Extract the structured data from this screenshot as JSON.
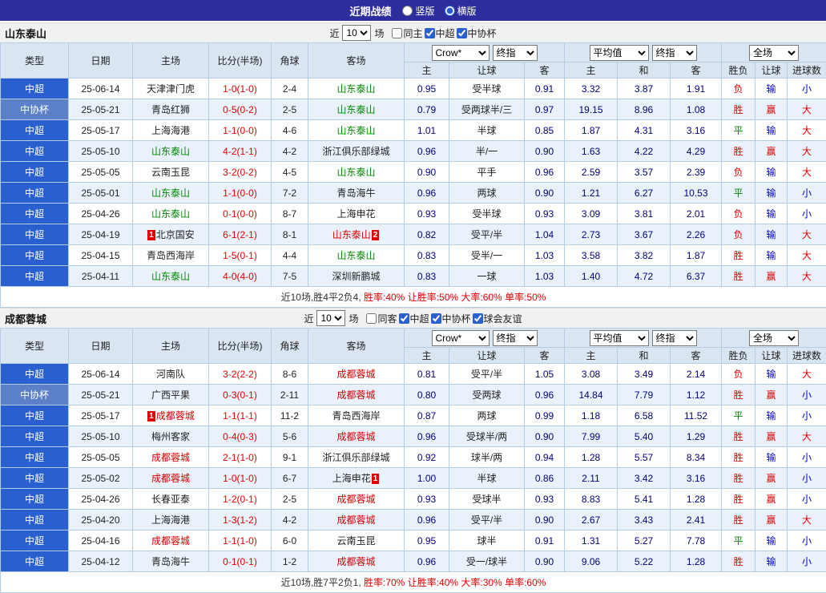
{
  "title_bar": {
    "title": "近期战绩",
    "radios": [
      {
        "label": "竖版",
        "checked": false
      },
      {
        "label": "横版",
        "checked": true
      }
    ]
  },
  "columns": {
    "type": "类型",
    "date": "日期",
    "home": "主场",
    "score": "比分(半场)",
    "corner": "角球",
    "away": "客场",
    "odds_home": "主",
    "handicap": "让球",
    "odds_away": "客",
    "avg_home": "主",
    "avg_draw": "和",
    "avg_away": "客",
    "result": "胜负",
    "handicap_result": "让球",
    "goals": "进球数"
  },
  "selects": {
    "bookmaker": "Crow*",
    "final_odds": "终指",
    "average": "平均值",
    "fulltime": "全场"
  },
  "sections": [
    {
      "team": "山东泰山",
      "filter": {
        "prefix": "近",
        "count": "10",
        "suffix": "场",
        "options": [
          {
            "label": "同主",
            "checked": false
          },
          {
            "label": "中超",
            "checked": true
          },
          {
            "label": "中协杯",
            "checked": true
          }
        ]
      },
      "rows": [
        [
          "中超",
          "25-06-14",
          {
            "n": "天津津门虎"
          },
          "1-0(1-0)",
          "2-4",
          {
            "n": "山东泰山",
            "c": "green"
          },
          "0.95",
          "受半球",
          "0.91",
          "3.32",
          "3.87",
          "1.91",
          "负",
          "输",
          "小"
        ],
        [
          "中协杯",
          "25-05-21",
          {
            "n": "青岛红狮"
          },
          "0-5(0-2)",
          "2-5",
          {
            "n": "山东泰山",
            "c": "green"
          },
          "0.79",
          "受两球半/三",
          "0.97",
          "19.15",
          "8.96",
          "1.08",
          "胜",
          "赢",
          "大"
        ],
        [
          "中超",
          "25-05-17",
          {
            "n": "上海海港"
          },
          "1-1(0-0)",
          "4-6",
          {
            "n": "山东泰山",
            "c": "green"
          },
          "1.01",
          "半球",
          "0.85",
          "1.87",
          "4.31",
          "3.16",
          "平",
          "输",
          "大"
        ],
        [
          "中超",
          "25-05-10",
          {
            "n": "山东泰山",
            "c": "green"
          },
          "4-2(1-1)",
          "4-2",
          {
            "n": "浙江俱乐部绿城"
          },
          "0.96",
          "半/一",
          "0.90",
          "1.63",
          "4.22",
          "4.29",
          "胜",
          "赢",
          "大"
        ],
        [
          "中超",
          "25-05-05",
          {
            "n": "云南玉昆"
          },
          "3-2(0-2)",
          "4-5",
          {
            "n": "山东泰山",
            "c": "green"
          },
          "0.90",
          "平手",
          "0.96",
          "2.59",
          "3.57",
          "2.39",
          "负",
          "输",
          "大"
        ],
        [
          "中超",
          "25-05-01",
          {
            "n": "山东泰山",
            "c": "green"
          },
          "1-1(0-0)",
          "7-2",
          {
            "n": "青岛海牛"
          },
          "0.96",
          "两球",
          "0.90",
          "1.21",
          "6.27",
          "10.53",
          "平",
          "输",
          "小"
        ],
        [
          "中超",
          "25-04-26",
          {
            "n": "山东泰山",
            "c": "green"
          },
          "0-1(0-0)",
          "8-7",
          {
            "n": "上海申花"
          },
          "0.93",
          "受半球",
          "0.93",
          "3.09",
          "3.81",
          "2.01",
          "负",
          "输",
          "小"
        ],
        [
          "中超",
          "25-04-19",
          {
            "n": "北京国安",
            "bb": "1"
          },
          "6-1(2-1)",
          "8-1",
          {
            "n": "山东泰山",
            "c": "red",
            "ba": "2"
          },
          "0.82",
          "受平/半",
          "1.04",
          "2.73",
          "3.67",
          "2.26",
          "负",
          "输",
          "大"
        ],
        [
          "中超",
          "25-04-15",
          {
            "n": "青岛西海岸"
          },
          "1-5(0-1)",
          "4-4",
          {
            "n": "山东泰山",
            "c": "green"
          },
          "0.83",
          "受半/一",
          "1.03",
          "3.58",
          "3.82",
          "1.87",
          "胜",
          "输",
          "大"
        ],
        [
          "中超",
          "25-04-11",
          {
            "n": "山东泰山",
            "c": "green"
          },
          "4-0(4-0)",
          "7-5",
          {
            "n": "深圳新鹏城"
          },
          "0.83",
          "一球",
          "1.03",
          "1.40",
          "4.72",
          "6.37",
          "胜",
          "赢",
          "大"
        ]
      ],
      "summary": [
        {
          "t": "近10场,胜4平2负4, ",
          "c": "dark"
        },
        {
          "t": "胜率:40% ",
          "c": "red"
        },
        {
          "t": "让胜率:50% ",
          "c": "red"
        },
        {
          "t": "大率:60% ",
          "c": "red"
        },
        {
          "t": "单率:50%",
          "c": "red"
        }
      ]
    },
    {
      "team": "成都蓉城",
      "filter": {
        "prefix": "近",
        "count": "10",
        "suffix": "场",
        "options": [
          {
            "label": "同客",
            "checked": false
          },
          {
            "label": "中超",
            "checked": true
          },
          {
            "label": "中协杯",
            "checked": true
          },
          {
            "label": "球会友谊",
            "checked": true
          }
        ]
      },
      "rows": [
        [
          "中超",
          "25-06-14",
          {
            "n": "河南队"
          },
          "3-2(2-2)",
          "8-6",
          {
            "n": "成都蓉城",
            "c": "red"
          },
          "0.81",
          "受平/半",
          "1.05",
          "3.08",
          "3.49",
          "2.14",
          "负",
          "输",
          "大"
        ],
        [
          "中协杯",
          "25-05-21",
          {
            "n": "广西平果"
          },
          "0-3(0-1)",
          "2-11",
          {
            "n": "成都蓉城",
            "c": "red"
          },
          "0.80",
          "受两球",
          "0.96",
          "14.84",
          "7.79",
          "1.12",
          "胜",
          "赢",
          "小"
        ],
        [
          "中超",
          "25-05-17",
          {
            "n": "成都蓉城",
            "c": "red",
            "bb": "1"
          },
          "1-1(1-1)",
          "11-2",
          {
            "n": "青岛西海岸"
          },
          "0.87",
          "两球",
          "0.99",
          "1.18",
          "6.58",
          "11.52",
          "平",
          "输",
          "小"
        ],
        [
          "中超",
          "25-05-10",
          {
            "n": "梅州客家"
          },
          "0-4(0-3)",
          "5-6",
          {
            "n": "成都蓉城",
            "c": "red"
          },
          "0.96",
          "受球半/两",
          "0.90",
          "7.99",
          "5.40",
          "1.29",
          "胜",
          "赢",
          "大"
        ],
        [
          "中超",
          "25-05-05",
          {
            "n": "成都蓉城",
            "c": "red"
          },
          "2-1(1-0)",
          "9-1",
          {
            "n": "浙江俱乐部绿城"
          },
          "0.92",
          "球半/两",
          "0.94",
          "1.28",
          "5.57",
          "8.34",
          "胜",
          "输",
          "小"
        ],
        [
          "中超",
          "25-05-02",
          {
            "n": "成都蓉城",
            "c": "red"
          },
          "1-0(1-0)",
          "6-7",
          {
            "n": "上海申花",
            "ba": "1"
          },
          "1.00",
          "半球",
          "0.86",
          "2.11",
          "3.42",
          "3.16",
          "胜",
          "赢",
          "小"
        ],
        [
          "中超",
          "25-04-26",
          {
            "n": "长春亚泰"
          },
          "1-2(0-1)",
          "2-5",
          {
            "n": "成都蓉城",
            "c": "red"
          },
          "0.93",
          "受球半",
          "0.93",
          "8.83",
          "5.41",
          "1.28",
          "胜",
          "赢",
          "小"
        ],
        [
          "中超",
          "25-04-20",
          {
            "n": "上海海港"
          },
          "1-3(1-2)",
          "4-2",
          {
            "n": "成都蓉城",
            "c": "red"
          },
          "0.96",
          "受平/半",
          "0.90",
          "2.67",
          "3.43",
          "2.41",
          "胜",
          "赢",
          "大"
        ],
        [
          "中超",
          "25-04-16",
          {
            "n": "成都蓉城",
            "c": "red"
          },
          "1-1(1-0)",
          "6-0",
          {
            "n": "云南玉昆"
          },
          "0.95",
          "球半",
          "0.91",
          "1.31",
          "5.27",
          "7.78",
          "平",
          "输",
          "小"
        ],
        [
          "中超",
          "25-04-12",
          {
            "n": "青岛海牛"
          },
          "0-1(0-1)",
          "1-2",
          {
            "n": "成都蓉城",
            "c": "red"
          },
          "0.96",
          "受一/球半",
          "0.90",
          "9.06",
          "5.22",
          "1.28",
          "胜",
          "输",
          "小"
        ]
      ],
      "summary": [
        {
          "t": "近10场,胜7平2负1, ",
          "c": "dark"
        },
        {
          "t": "胜率:70% ",
          "c": "red"
        },
        {
          "t": "让胜率:40% ",
          "c": "red"
        },
        {
          "t": "大率:30% ",
          "c": "red"
        },
        {
          "t": "单率:60%",
          "c": "red"
        }
      ]
    }
  ],
  "colors": {
    "theme": {
      "titlebar": "#2d2d9e",
      "headbg": "#d9e5f1",
      "rowalt": "#e9f2fb",
      "border": "#b6cce2",
      "red": "#e00000",
      "green": "#008800",
      "blue": "#0000d0",
      "navy": "#000080",
      "teamgreen": "#008800",
      "teamred": "#d40000"
    },
    "type_colors": {
      "中超": "#2a5fd0",
      "中协杯": "#5c80c8"
    },
    "word_colors": {
      "胜": "red",
      "平": "green",
      "负": "red",
      "赢": "red",
      "输": "blue",
      "大": "red",
      "小": "blue"
    }
  }
}
